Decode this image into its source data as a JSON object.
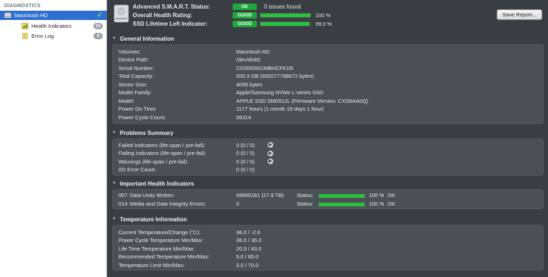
{
  "sidebar": {
    "header": "DIAGNOSTICS",
    "items": [
      {
        "label": "Macintosh HD",
        "status": "ok"
      },
      {
        "label": "Health Indicators",
        "badge": "15"
      },
      {
        "label": "Error Log",
        "badge": "0"
      }
    ]
  },
  "topbar": {
    "smart_label": "Advanced S.M.A.R.T. Status:",
    "smart_badge": "OK",
    "smart_text": "0 issues found",
    "health_label": "Overall Health Rating:",
    "health_badge": "GOOD",
    "health_progress": 1.0,
    "health_value": "100 %",
    "ssd_label": "SSD Lifetime Left Indicator:",
    "ssd_badge": "GOOD",
    "ssd_progress": 0.99,
    "ssd_value": "99.0 %",
    "save_label": "Save Report..."
  },
  "general": {
    "title": "General Information",
    "rows": [
      {
        "k": "Volumes:",
        "v": "Macintosh HD"
      },
      {
        "k": "Device Path:",
        "v": "/dev/disk0"
      },
      {
        "k": "Serial Number:",
        "v": "C02650501MBHCFK1R"
      },
      {
        "k": "Total Capacity:",
        "v": "500.3 GB (500277788672 bytes)"
      },
      {
        "k": "Sector Size:",
        "v": "4096 bytes"
      },
      {
        "k": "Model Family:",
        "v": "Apple/Samsung NVMe L-series SSD"
      },
      {
        "k": "Model:",
        "v": "APPLE SSD SM0512L  (Firmware Version: CXS6AA0Q)"
      },
      {
        "k": "Power On Time:",
        "v": "1177 hours (1 month 19 days 1 hour)"
      },
      {
        "k": "Power Cycle Count:",
        "v": "56314"
      }
    ]
  },
  "problems": {
    "title": "Problems Summary",
    "rows": [
      {
        "k": "Failed Indicators (life-span / pre-fail):",
        "v": "0 (0 / 0)",
        "arrow": true
      },
      {
        "k": "Failing Indicators (life-span / pre-fail):",
        "v": "0 (0 / 0)",
        "arrow": true
      },
      {
        "k": "Warnings (life-span / pre-fail):",
        "v": "0 (0 / 0)",
        "arrow": true
      },
      {
        "k": "I/O Error Count:",
        "v": "0 (0 / 0)",
        "arrow": false
      }
    ]
  },
  "health": {
    "title": "Important Health Indicators",
    "rows": [
      {
        "id": "007",
        "name": "Data Units Written:",
        "value": "59890181 (27.9 TB)",
        "status_label": "Status:",
        "progress": 1.0,
        "pct": "100 %",
        "result": "OK"
      },
      {
        "id": "014",
        "name": "Media and Data Integrity Errors:",
        "value": "0",
        "status_label": "Status:",
        "progress": 1.0,
        "pct": "100 %",
        "result": "OK"
      }
    ]
  },
  "temperature": {
    "title": "Temperature Information",
    "rows": [
      {
        "k": "Current Temperature/Change (°C):",
        "v": "36.0 / -2.0"
      },
      {
        "k": "Power Cycle Temperature Min/Max:",
        "v": "36.0 / 36.0"
      },
      {
        "k": "Life Time Temperature Min/Max:",
        "v": "20.0 / 43.0"
      },
      {
        "k": "Recommended Temperature Min/Max:",
        "v": "5.0   / 65.0"
      },
      {
        "k": "Temperature Limit Min/Max:",
        "v": "5.0   / 70.0"
      }
    ]
  },
  "icons": {
    "disk": "hard-disk-icon",
    "health": "health-indicators-icon",
    "log": "error-log-icon",
    "section_toggle": "disclosure-triangle-icon",
    "detail_arrow": "detail-arrow-icon"
  },
  "colors": {
    "selection": "#2f6fd0",
    "good": "#1fa83b",
    "bar_fill": "#27c43e",
    "panel": "#4b5057",
    "background": "#3a3e44"
  }
}
